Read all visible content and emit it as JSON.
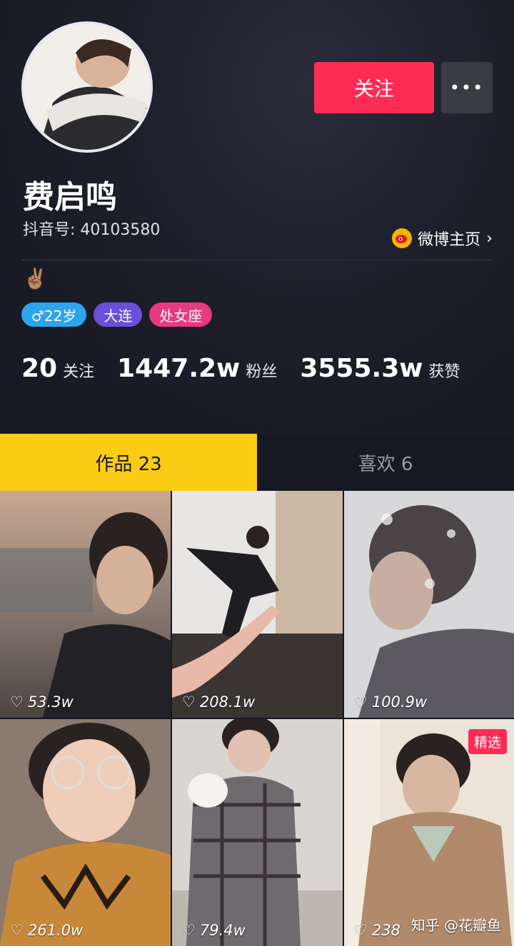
{
  "profile": {
    "nickname": "费启鸣",
    "douyin_id": "抖音号: 40103580",
    "weibo_label": "微博主页",
    "bio": "✌🏽",
    "follow_label": "关注",
    "more_label": "•••",
    "tags": {
      "gender_age": "♂22岁",
      "city": "大连",
      "zodiac": "处女座"
    }
  },
  "stats": [
    {
      "value": "20",
      "label": "关注"
    },
    {
      "value": "1447.2w",
      "label": "粉丝"
    },
    {
      "value": "3555.3w",
      "label": "获赞"
    }
  ],
  "tabs": [
    {
      "label": "作品 23"
    },
    {
      "label": "喜欢 6"
    }
  ],
  "videos": [
    {
      "likes": "53.3w"
    },
    {
      "likes": "208.1w"
    },
    {
      "likes": "100.9w"
    },
    {
      "likes": "261.0w"
    },
    {
      "likes": "79.4w"
    },
    {
      "likes": "238",
      "badge": "精选"
    }
  ],
  "watermark": "知乎 @花瓣鱼",
  "colors": {
    "accent": "#fe2c55",
    "tab_active": "#facc15",
    "background": "#161823"
  }
}
